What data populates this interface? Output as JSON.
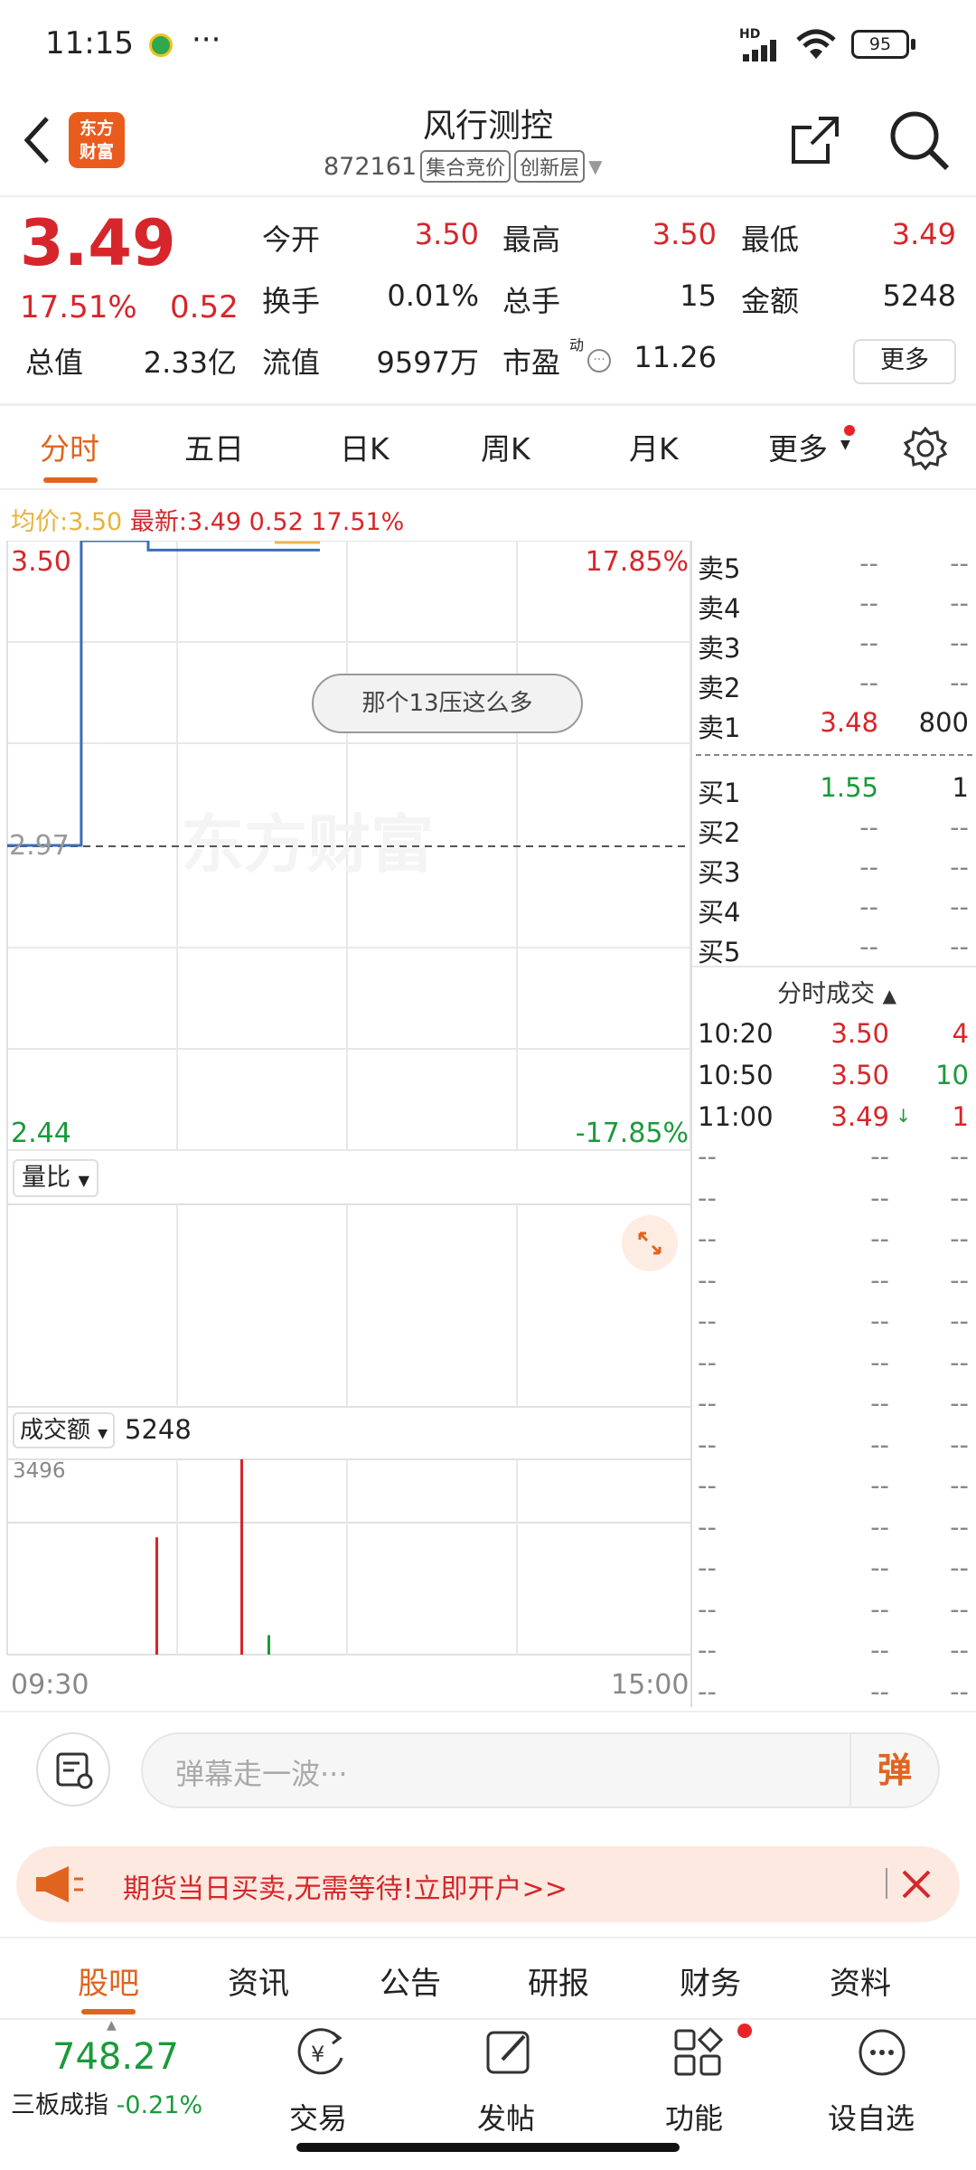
{
  "status": {
    "time": "11:15",
    "dots": "···",
    "net": "HD",
    "battery": "95"
  },
  "header": {
    "title": "风行测控",
    "code": "872161",
    "tag1": "集合竞价",
    "tag2": "创新层",
    "logo": "东方\n财富"
  },
  "quote": {
    "price": "3.49",
    "pct": "17.51%",
    "chg": "0.52",
    "rows": [
      [
        {
          "k": "今开",
          "v": "3.50",
          "c": "red"
        },
        {
          "k": "最高",
          "v": "3.50",
          "c": "red"
        },
        {
          "k": "最低",
          "v": "3.49",
          "c": "red"
        }
      ],
      [
        {
          "k": "换手",
          "v": "0.01%",
          "c": "n"
        },
        {
          "k": "总手",
          "v": "15",
          "c": "n"
        },
        {
          "k": "金额",
          "v": "5248",
          "c": "n"
        }
      ],
      [
        {
          "k": "总值",
          "v": "2.33亿",
          "c": "n"
        },
        {
          "k": "流值",
          "v": "9597万",
          "c": "n"
        },
        {
          "k": "市盈",
          "v": "11.26",
          "c": "n"
        }
      ]
    ],
    "pe_sup": "动",
    "more": "更多"
  },
  "tabs": [
    "分时",
    "五日",
    "日K",
    "周K",
    "月K",
    "更多"
  ],
  "info": {
    "avg_label": "均价:",
    "avg": "3.50",
    "last_label": "最新:",
    "last": "3.49",
    "chg": "0.52",
    "pct": "17.51%"
  },
  "chart": {
    "y_top": "3.50",
    "y_mid": "2.97",
    "y_bot": "2.44",
    "pct_top": "17.85%",
    "pct_bot": "-17.85%",
    "bubble": "那个13压这么多",
    "watermark": "东方财富",
    "vol_ratio_label": "量比",
    "amount_label": "成交额",
    "amount_value": "5248",
    "amount_max": "3496",
    "t_start": "09:30",
    "t_end": "15:00"
  },
  "chart_data": {
    "type": "line",
    "x": [
      "09:30",
      "09:56",
      "15:00"
    ],
    "price": [
      2.97,
      3.5,
      3.49
    ],
    "avg": [
      3.5
    ],
    "ylim": [
      2.44,
      3.5
    ],
    "amounts": [
      {
        "t": "09:56",
        "v": 2100,
        "c": "red"
      },
      {
        "t": "10:50",
        "v": 3496,
        "c": "red"
      },
      {
        "t": "11:00",
        "v": 349,
        "c": "green"
      }
    ]
  },
  "orderbook": {
    "asks": [
      {
        "l": "卖5",
        "p": "--",
        "v": "--"
      },
      {
        "l": "卖4",
        "p": "--",
        "v": "--"
      },
      {
        "l": "卖3",
        "p": "--",
        "v": "--"
      },
      {
        "l": "卖2",
        "p": "--",
        "v": "--"
      },
      {
        "l": "卖1",
        "p": "3.48",
        "v": "800"
      }
    ],
    "bids": [
      {
        "l": "买1",
        "p": "1.55",
        "v": "1"
      },
      {
        "l": "买2",
        "p": "--",
        "v": "--"
      },
      {
        "l": "买3",
        "p": "--",
        "v": "--"
      },
      {
        "l": "买4",
        "p": "--",
        "v": "--"
      },
      {
        "l": "买5",
        "p": "--",
        "v": "--"
      }
    ]
  },
  "trades": {
    "title": "分时成交",
    "rows": [
      {
        "t": "10:20",
        "p": "3.50",
        "v": "4",
        "vc": "red"
      },
      {
        "t": "10:50",
        "p": "3.50",
        "v": "10",
        "vc": "green"
      },
      {
        "t": "11:00",
        "p": "3.49",
        "v": "1",
        "vc": "red"
      }
    ],
    "empty": "--"
  },
  "comment": {
    "placeholder": "弹幕走一波···",
    "btn": "弹"
  },
  "ad": {
    "text": "期货当日买卖,无需等待!立即开户>>"
  },
  "subtabs": [
    "股吧",
    "资讯",
    "公告",
    "研报",
    "财务",
    "资料"
  ],
  "bottom": {
    "index_val": "748.27",
    "index_name": "三板成指",
    "index_pct": "-0.21%",
    "items": [
      "交易",
      "发帖",
      "功能",
      "设自选"
    ]
  }
}
